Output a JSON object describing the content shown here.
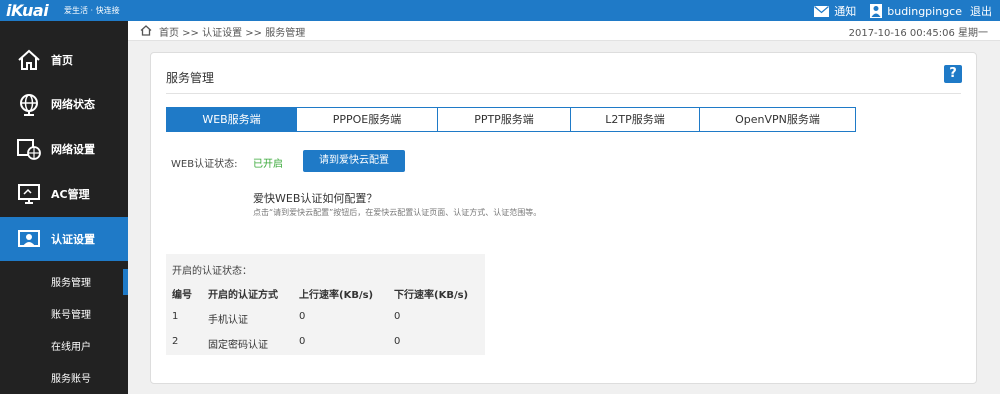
{
  "topbar": {
    "logo": "iKuai",
    "slogan": "爱生活 · 快连接",
    "notice_label": "通知",
    "username": "budingpingce",
    "logout_label": "退出"
  },
  "sidebar": {
    "items": [
      {
        "label": "首页",
        "icon": "home-icon"
      },
      {
        "label": "网络状态",
        "icon": "globe-icon"
      },
      {
        "label": "网络设置",
        "icon": "network-settings-icon"
      },
      {
        "label": "AC管理",
        "icon": "monitor-icon"
      },
      {
        "label": "认证设置",
        "icon": "auth-settings-icon"
      }
    ],
    "sub_items": [
      {
        "label": "服务管理"
      },
      {
        "label": "账号管理"
      },
      {
        "label": "在线用户"
      },
      {
        "label": "服务账号"
      }
    ]
  },
  "breadcrumb": {
    "text": "首页 >> 认证设置 >> 服务管理",
    "datetime": "2017-10-16  00:45:06  星期一"
  },
  "panel": {
    "title": "服务管理",
    "help": "?",
    "tabs": [
      {
        "label": "WEB服务端"
      },
      {
        "label": "PPPOE服务端"
      },
      {
        "label": "PPTP服务端"
      },
      {
        "label": "L2TP服务端"
      },
      {
        "label": "OpenVPN服务端"
      }
    ],
    "status_label": "WEB认证状态:",
    "status_value": "已开启",
    "config_button": "请到爱快云配置",
    "howto_title": "爱快WEB认证如何配置？",
    "howto_desc": "点击“请到爱快云配置”按钮后，在爱快云配置认证页面、认证方式、认证范围等。",
    "auth_box": {
      "title": "开启的认证状态：",
      "headers": [
        "编号",
        "开启的认证方式",
        "上行速率(KB/s)",
        "下行速率(KB/s)"
      ],
      "rows": [
        [
          "1",
          "手机认证",
          "0",
          "0"
        ],
        [
          "2",
          "固定密码认证",
          "0",
          "0"
        ]
      ]
    }
  },
  "colors": {
    "accent": "#1f7ac7",
    "sidebar_bg": "#222222",
    "enabled": "#3aa93a"
  }
}
